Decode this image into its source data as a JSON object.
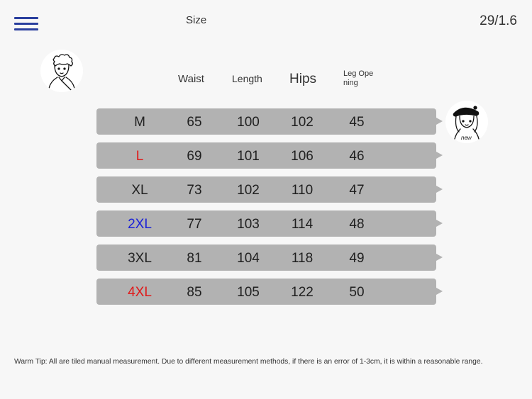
{
  "header": {
    "title": "Size",
    "page_counter": "29/1.6"
  },
  "table": {
    "columns": {
      "waist": "Waist",
      "length": "Length",
      "hips": "Hips",
      "leg_opening": "Leg Ope ning"
    },
    "rows": [
      {
        "size": "M",
        "size_color": "#222222",
        "waist": "65",
        "length": "100",
        "hips": "102",
        "leg_opening": "45"
      },
      {
        "size": "L",
        "size_color": "#e01919",
        "waist": "69",
        "length": "101",
        "hips": "106",
        "leg_opening": "46"
      },
      {
        "size": "XL",
        "size_color": "#222222",
        "waist": "73",
        "length": "102",
        "hips": "110",
        "leg_opening": "47"
      },
      {
        "size": "2XL",
        "size_color": "#1a22d8",
        "waist": "77",
        "length": "103",
        "hips": "114",
        "leg_opening": "48"
      },
      {
        "size": "3XL",
        "size_color": "#222222",
        "waist": "81",
        "length": "104",
        "hips": "118",
        "leg_opening": "49"
      },
      {
        "size": "4XL",
        "size_color": "#e01919",
        "waist": "85",
        "length": "105",
        "hips": "122",
        "leg_opening": "50"
      }
    ]
  },
  "avatars": {
    "right_caption": "new"
  },
  "footer": {
    "tip": "Warm Tip: All are tiled manual measurement. Due to different measurement methods, if there is an error of 1-3cm, it is within a reasonable range."
  },
  "colors": {
    "menu": "#2a3f9e",
    "row_background": "#b2b2b2",
    "page_background": "#f7f7f7"
  },
  "icons": [
    "menu-icon",
    "boy-cartoon-avatar",
    "girl-cartoon-avatar"
  ]
}
